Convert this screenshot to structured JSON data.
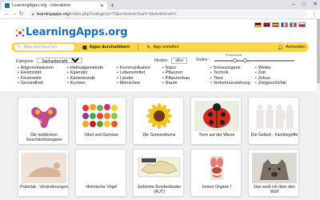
{
  "browser": {
    "tab_title": "LearningApps.org - interaktive",
    "new_tab": "+",
    "window_controls": [
      "–",
      "□",
      "✕"
    ],
    "url_host": "learningapps.org",
    "url_path": "/index.php?category=76&s=&stufeStart=1&stufeEnd=1"
  },
  "header": {
    "logo_text": "LearningApps.org",
    "flags": [
      {
        "name": "de",
        "colors": [
          "#000000",
          "#dd0000",
          "#ffce00"
        ]
      },
      {
        "name": "gb",
        "colors": [
          "#012169",
          "#ffffff",
          "#c8102e"
        ]
      },
      {
        "name": "es",
        "colors": [
          "#aa151b",
          "#f1bf00",
          "#aa151b"
        ]
      },
      {
        "name": "fr",
        "colors": [
          "#0055a4",
          "#ffffff",
          "#ef4135"
        ]
      },
      {
        "name": "it",
        "colors": [
          "#009246",
          "#ffffff",
          "#ce2b37"
        ]
      },
      {
        "name": "ru",
        "colors": [
          "#ffffff",
          "#0039a6",
          "#d52b1e"
        ]
      }
    ]
  },
  "nav": {
    "search_placeholder": "Apps durchsuchen",
    "browse_label": "Apps durchstöbern",
    "create_label": "App erstellen",
    "login_label": "Anmelden",
    "accent": "#fbd54a"
  },
  "filters": {
    "category_label": "Kategorie:",
    "category_value": "Sachunterricht",
    "media_label": "Medien:",
    "media_value": "alles",
    "levels_label": "Stufen:",
    "level_value_label": "Primarstufe",
    "level_range": [
      0.25,
      0.38
    ]
  },
  "categories": [
    [
      "Allgemeinwissen",
      "Elektrizität",
      "Feuerwehr",
      "Gesundheit"
    ],
    [
      "Heimatgemeinde",
      "Kalender",
      "Kartenkunde",
      "Kochen"
    ],
    [
      "Kommunikation",
      "Lebensmittel",
      "Länder",
      "Menschen"
    ],
    [
      "Natur",
      "Pflanzen",
      "Pflanzenbau",
      "Raum"
    ],
    [
      "Sinnesorgane",
      "Technik",
      "Tiere",
      "Verkehrserziehung"
    ],
    [
      "Wetter",
      "Zeit",
      "Zirkus",
      "Zeitgeschichte"
    ]
  ],
  "cards": [
    {
      "title": "Die weiblichen Geschlechtsorgane",
      "icon": "anatomy-image"
    },
    {
      "title": "Obst und Gemüse",
      "icon": "fruit-image"
    },
    {
      "title": "Die Sonnenblume",
      "icon": "sunflower-image"
    },
    {
      "title": "Tiere auf der Wiese",
      "icon": "ladybug-image"
    },
    {
      "title": "Die Geburt - Fachbegriffe",
      "icon": "pregnancy-image"
    },
    {
      "title": "Pubertät - Veränderungen",
      "icon": "body-image"
    },
    {
      "title": "Heimische Vögel",
      "icon": "bird-image"
    },
    {
      "title": "Geheime Bundesländer (AUT)",
      "icon": "map-image"
    },
    {
      "title": "Innere Organe I",
      "icon": "organs-image"
    },
    {
      "title": "Das weiß ich über den Wolf",
      "icon": "wolf-image"
    }
  ]
}
